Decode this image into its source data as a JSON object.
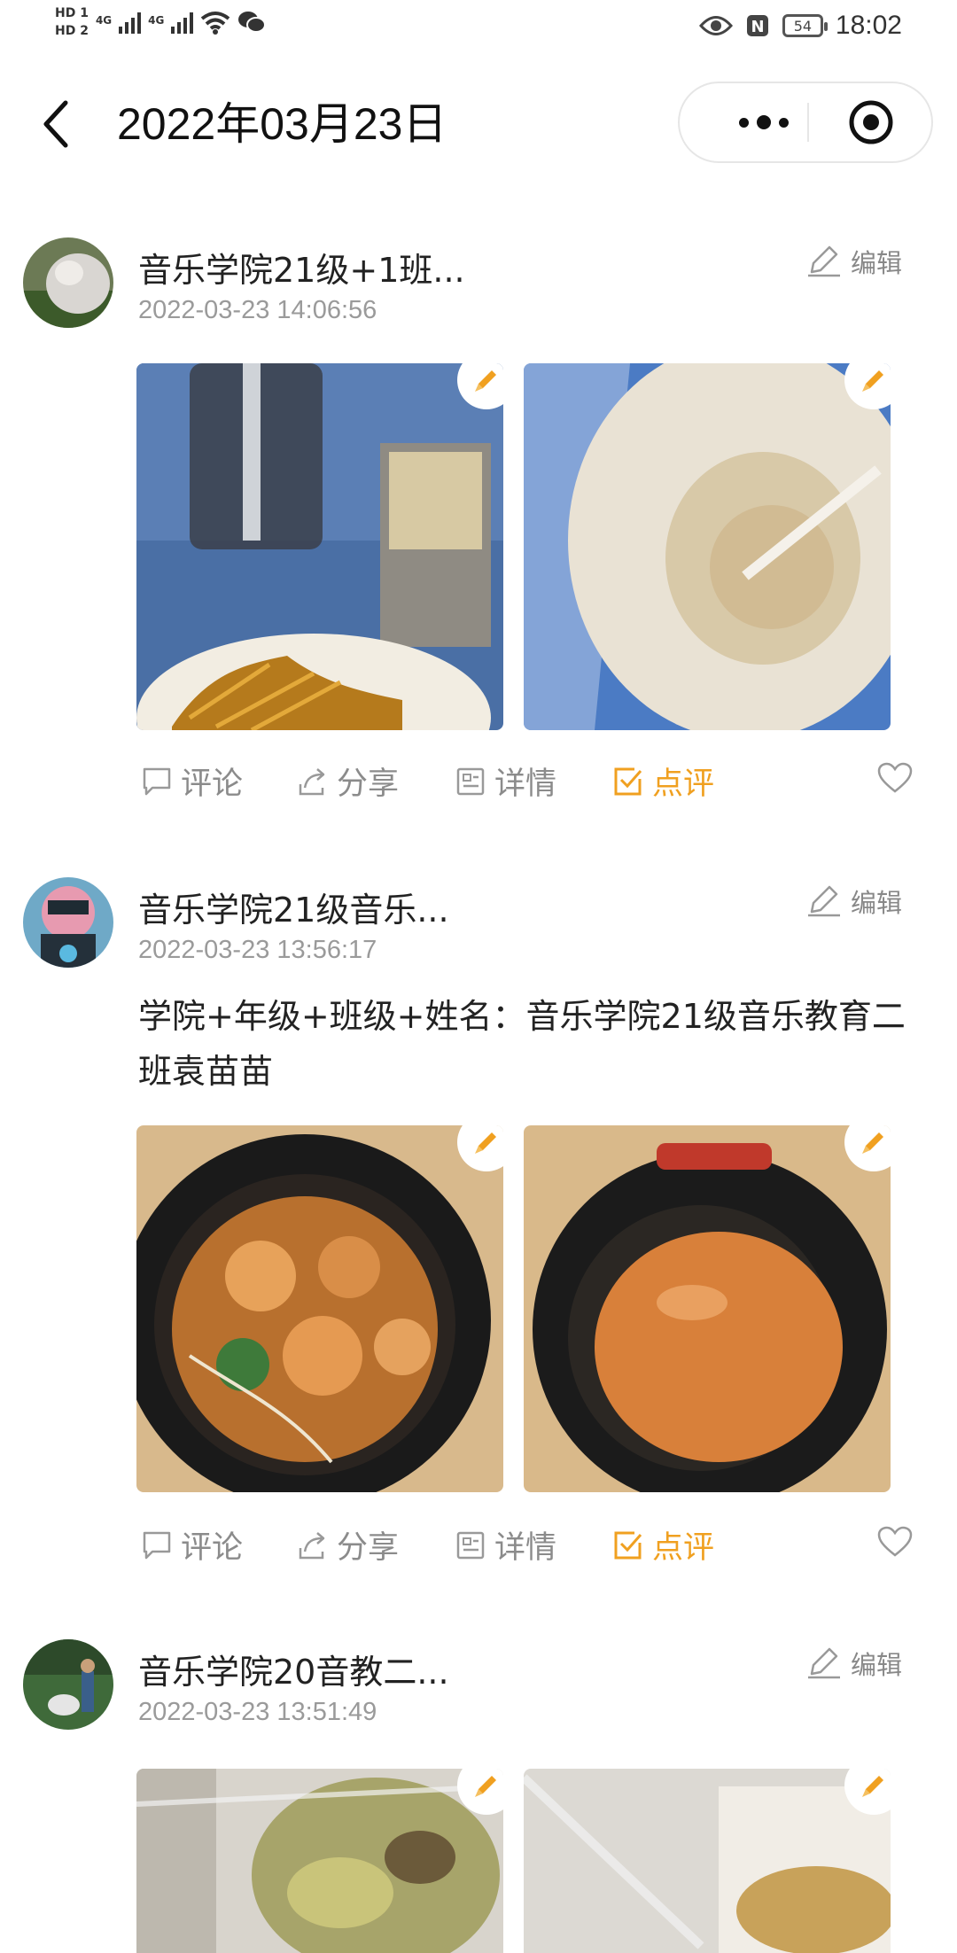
{
  "status_bar": {
    "hd1": "HD 1",
    "hd2": "HD 2",
    "net1": "4G",
    "net2": "4G",
    "battery": "54",
    "nfc": "N",
    "time": "18:02"
  },
  "nav": {
    "title": "2022年03月23日"
  },
  "colors": {
    "accent": "#f0a020",
    "muted": "#8b8b8b"
  },
  "posts": [
    {
      "name": "音乐学院21级+1班...",
      "time": "2022-03-23 14:06:56",
      "edit_label": "编辑",
      "text": "",
      "actions": {
        "comment": "评论",
        "share": "分享",
        "detail": "详情",
        "review": "点评"
      }
    },
    {
      "name": "音乐学院21级音乐...",
      "time": "2022-03-23 13:56:17",
      "edit_label": "编辑",
      "text": "学院+年级+班级+姓名：音乐学院21级音乐教育二班袁苗苗",
      "actions": {
        "comment": "评论",
        "share": "分享",
        "detail": "详情",
        "review": "点评"
      }
    },
    {
      "name": "音乐学院20音教二...",
      "time": "2022-03-23 13:51:49",
      "edit_label": "编辑",
      "text": ""
    }
  ]
}
